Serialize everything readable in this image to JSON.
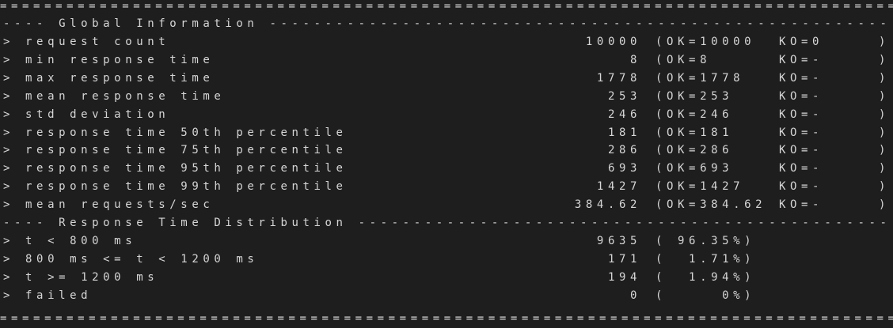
{
  "separators": {
    "top": "==========================================================================================",
    "bottom": "=========================================================================================="
  },
  "global_header": "---- Global Information --------------------------------------------------------",
  "distribution_header": "---- Response Time Distribution ------------------------------------------------",
  "stats": [
    {
      "label": "> request count",
      "value": "10000",
      "ok": "(OK=10000",
      "ko": "KO=0",
      "close": ")"
    },
    {
      "label": "> min response time",
      "value": "8",
      "ok": "(OK=8",
      "ko": "KO=-",
      "close": ")"
    },
    {
      "label": "> max response time",
      "value": "1778",
      "ok": "(OK=1778",
      "ko": "KO=-",
      "close": ")"
    },
    {
      "label": "> mean response time",
      "value": "253",
      "ok": "(OK=253",
      "ko": "KO=-",
      "close": ")"
    },
    {
      "label": "> std deviation",
      "value": "246",
      "ok": "(OK=246",
      "ko": "KO=-",
      "close": ")"
    },
    {
      "label": "> response time 50th percentile",
      "value": "181",
      "ok": "(OK=181",
      "ko": "KO=-",
      "close": ")"
    },
    {
      "label": "> response time 75th percentile",
      "value": "286",
      "ok": "(OK=286",
      "ko": "KO=-",
      "close": ")"
    },
    {
      "label": "> response time 95th percentile",
      "value": "693",
      "ok": "(OK=693",
      "ko": "KO=-",
      "close": ")"
    },
    {
      "label": "> response time 99th percentile",
      "value": "1427",
      "ok": "(OK=1427",
      "ko": "KO=-",
      "close": ")"
    },
    {
      "label": "> mean requests/sec",
      "value": "384.62",
      "ok": "(OK=384.62",
      "ko": "KO=-",
      "close": ")"
    }
  ],
  "distribution": [
    {
      "label": "> t < 800 ms",
      "value": "9635",
      "pct": "( 96.35%)"
    },
    {
      "label": "> 800 ms <= t < 1200 ms",
      "value": "171",
      "pct": "(  1.71%)"
    },
    {
      "label": "> t >= 1200 ms",
      "value": "194",
      "pct": "(  1.94%)"
    },
    {
      "label": "> failed",
      "value": "0",
      "pct": "(     0%)"
    }
  ],
  "colors": {
    "background": "#1e1e1e",
    "text": "#d6d6d6"
  }
}
